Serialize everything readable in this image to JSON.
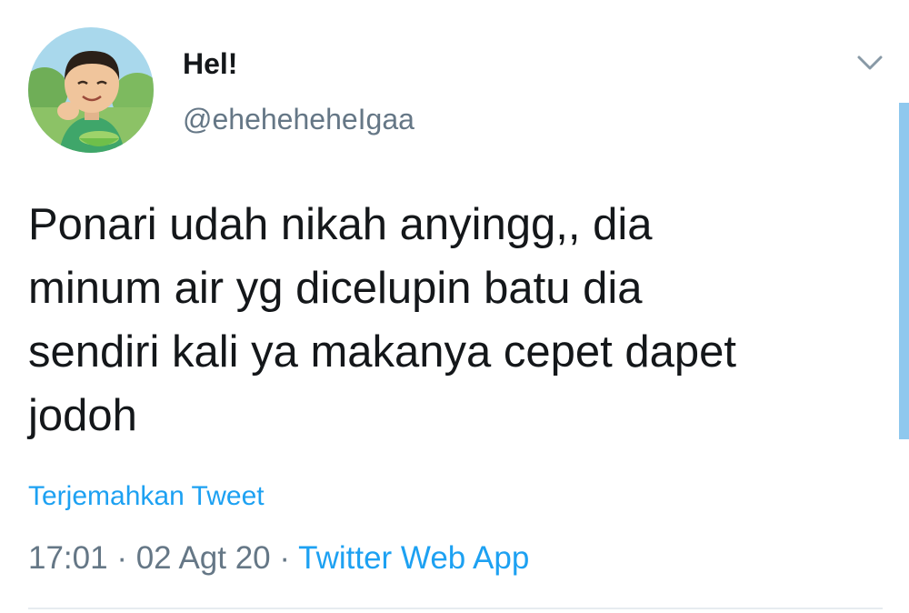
{
  "author": {
    "display_name": "Hel!",
    "handle": "@eheheheheIgaa"
  },
  "tweet": {
    "text": "Ponari udah nikah anyingg,, dia\nminum air yg dicelupin batu dia\nsendiri kali ya makanya cepet dapet\njodoh",
    "translate_label": "Terjemahkan Tweet",
    "time": "17:01",
    "date": "02 Agt 20",
    "separator": "·",
    "source": "Twitter Web App"
  },
  "icons": {
    "menu": "chevron-down-icon",
    "avatar": "avatar"
  },
  "colors": {
    "accent": "#1da1f2",
    "secondary_text": "#657786",
    "primary_text": "#14171a",
    "divider": "#e6ecf0"
  }
}
